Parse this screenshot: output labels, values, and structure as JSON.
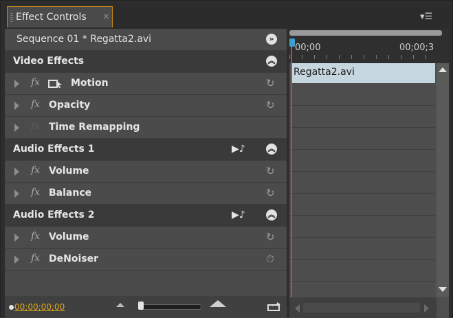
{
  "panel": {
    "title": "Effect Controls",
    "close": "×",
    "menu": "▾☰"
  },
  "sequence": {
    "label": "Sequence 01 * Regatta2.avi"
  },
  "sections": {
    "video": "Video Effects",
    "audio1": "Audio Effects 1",
    "audio2": "Audio Effects 2"
  },
  "effects": {
    "motion": "Motion",
    "opacity": "Opacity",
    "time_remapping": "Time Remapping",
    "volume1": "Volume",
    "balance": "Balance",
    "volume2": "Volume",
    "denoiser": "DeNoiser"
  },
  "fx_symbol": "fx",
  "footer": {
    "timecode": "00;00;00;00"
  },
  "timeline": {
    "start": "00;00",
    "end": "00;00;3",
    "clip": "Regatta2.avi"
  },
  "colors": {
    "accent": "#c88a18",
    "timecode": "#e0a81a",
    "playhead": "#d84040",
    "clip": "#c6d6df"
  }
}
